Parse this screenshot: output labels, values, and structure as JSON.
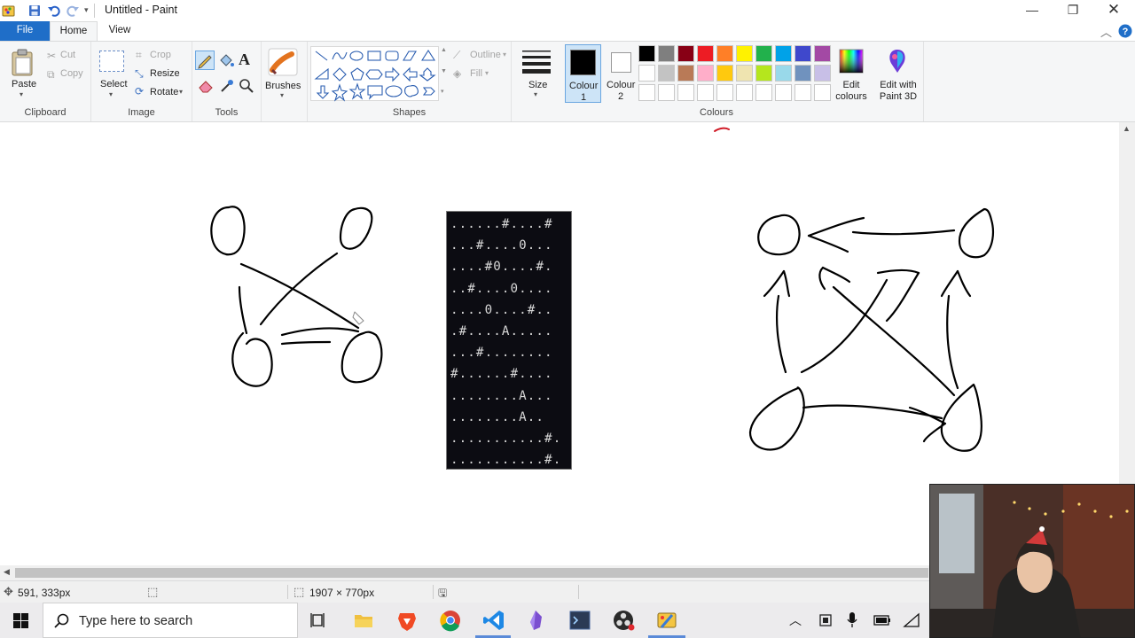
{
  "window": {
    "title": "Untitled - Paint",
    "controls": [
      "minimize-icon",
      "restore-icon",
      "close-icon"
    ]
  },
  "menu": {
    "file": "File",
    "home": "Home",
    "view": "View"
  },
  "ribbon": {
    "clipboard": {
      "label": "Clipboard",
      "paste": "Paste",
      "cut": "Cut",
      "copy": "Copy"
    },
    "image": {
      "label": "Image",
      "select": "Select",
      "crop": "Crop",
      "resize": "Resize",
      "rotate": "Rotate"
    },
    "tools": {
      "label": "Tools"
    },
    "brushes": {
      "label": "Brushes"
    },
    "shapes": {
      "label": "Shapes",
      "outline": "Outline",
      "fill": "Fill"
    },
    "size": {
      "label": "Size"
    },
    "colours": {
      "label": "Colours",
      "colour1": "Colour 1",
      "colour2": "Colour 2",
      "edit_colours": "Edit colours",
      "edit_paint3d": "Edit with Paint 3D",
      "colour1_value": "#000000",
      "colour2_value": "#ffffff",
      "palette_row1": [
        "#000000",
        "#7f7f7f",
        "#880015",
        "#ed1c24",
        "#ff7f27",
        "#fff200",
        "#22b14c",
        "#00a2e8",
        "#3f48cc",
        "#a349a4"
      ],
      "palette_row2": [
        "#ffffff",
        "#c3c3c3",
        "#b97a57",
        "#ffaec9",
        "#ffc90e",
        "#efe4b0",
        "#b5e61d",
        "#99d9ea",
        "#7092be",
        "#c8bfe7"
      ],
      "palette_row3": [
        "#ffffff",
        "#ffffff",
        "#ffffff",
        "#ffffff",
        "#ffffff",
        "#ffffff",
        "#ffffff",
        "#ffffff",
        "#ffffff",
        "#ffffff"
      ]
    }
  },
  "terminal": {
    "rows": [
      "......#....#",
      "...#....0...",
      "....#0....#.",
      "..#....0....",
      "....0....#..",
      ".#....A.....",
      "...#........",
      "#......#....",
      "........A...",
      "........A..",
      "...........#.",
      "...........#."
    ]
  },
  "status": {
    "cursor_position": "591, 333px",
    "canvas_size": "1907 × 770px"
  },
  "taskbar": {
    "search_placeholder": "Type here to search",
    "apps": [
      "task-view-icon",
      "file-explorer-icon",
      "brave-browser-icon",
      "chrome-icon",
      "vscode-icon",
      "obsidian-icon",
      "terminal-app-icon",
      "obs-icon",
      "paint-icon"
    ],
    "tray": [
      "chevron-up-icon",
      "tray-app-icon",
      "microphone-icon",
      "battery-icon",
      "wifi-icon"
    ]
  }
}
